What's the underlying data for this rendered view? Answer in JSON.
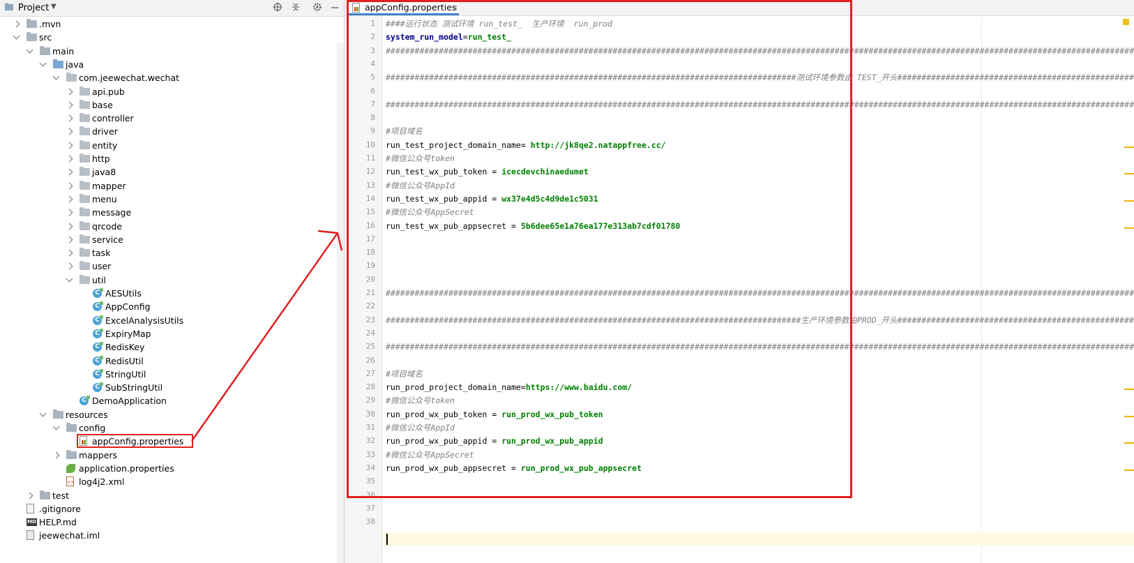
{
  "project_panel": {
    "title": "Project",
    "icons": [
      "locate-icon",
      "collapse-icon",
      "gear-icon",
      "minimize-icon"
    ],
    "tree": [
      {
        "label": ".mvn",
        "depth": 1,
        "expand": "collapsed",
        "icon": "folder"
      },
      {
        "label": "src",
        "depth": 1,
        "expand": "expanded",
        "icon": "folder"
      },
      {
        "label": "main",
        "depth": 2,
        "expand": "expanded",
        "icon": "folder"
      },
      {
        "label": "java",
        "depth": 3,
        "expand": "expanded",
        "icon": "folder-src"
      },
      {
        "label": "com.jeewechat.wechat",
        "depth": 4,
        "expand": "expanded",
        "icon": "package"
      },
      {
        "label": "api.pub",
        "depth": 5,
        "expand": "collapsed",
        "icon": "package"
      },
      {
        "label": "base",
        "depth": 5,
        "expand": "collapsed",
        "icon": "package"
      },
      {
        "label": "controller",
        "depth": 5,
        "expand": "collapsed",
        "icon": "package"
      },
      {
        "label": "driver",
        "depth": 5,
        "expand": "collapsed",
        "icon": "package"
      },
      {
        "label": "entity",
        "depth": 5,
        "expand": "collapsed",
        "icon": "package"
      },
      {
        "label": "http",
        "depth": 5,
        "expand": "collapsed",
        "icon": "package"
      },
      {
        "label": "java8",
        "depth": 5,
        "expand": "collapsed",
        "icon": "package"
      },
      {
        "label": "mapper",
        "depth": 5,
        "expand": "collapsed",
        "icon": "package"
      },
      {
        "label": "menu",
        "depth": 5,
        "expand": "collapsed",
        "icon": "package"
      },
      {
        "label": "message",
        "depth": 5,
        "expand": "collapsed",
        "icon": "package"
      },
      {
        "label": "qrcode",
        "depth": 5,
        "expand": "collapsed",
        "icon": "package"
      },
      {
        "label": "service",
        "depth": 5,
        "expand": "collapsed",
        "icon": "package"
      },
      {
        "label": "task",
        "depth": 5,
        "expand": "collapsed",
        "icon": "package"
      },
      {
        "label": "user",
        "depth": 5,
        "expand": "collapsed",
        "icon": "package"
      },
      {
        "label": "util",
        "depth": 5,
        "expand": "expanded",
        "icon": "package"
      },
      {
        "label": "AESUtils",
        "depth": 6,
        "expand": "none",
        "icon": "class"
      },
      {
        "label": "AppConfig",
        "depth": 6,
        "expand": "none",
        "icon": "class"
      },
      {
        "label": "ExcelAnalysisUtils",
        "depth": 6,
        "expand": "none",
        "icon": "class"
      },
      {
        "label": "ExpiryMap",
        "depth": 6,
        "expand": "none",
        "icon": "class"
      },
      {
        "label": "RedisKey",
        "depth": 6,
        "expand": "none",
        "icon": "class"
      },
      {
        "label": "RedisUtil",
        "depth": 6,
        "expand": "none",
        "icon": "class"
      },
      {
        "label": "StringUtil",
        "depth": 6,
        "expand": "none",
        "icon": "class"
      },
      {
        "label": "SubStringUtil",
        "depth": 6,
        "expand": "none",
        "icon": "class"
      },
      {
        "label": "DemoApplication",
        "depth": 5,
        "expand": "none",
        "icon": "class"
      },
      {
        "label": "resources",
        "depth": 3,
        "expand": "expanded",
        "icon": "folder-res"
      },
      {
        "label": "config",
        "depth": 4,
        "expand": "expanded",
        "icon": "folder"
      },
      {
        "label": "appConfig.properties",
        "depth": 5,
        "expand": "none",
        "icon": "properties"
      },
      {
        "label": "mappers",
        "depth": 4,
        "expand": "collapsed",
        "icon": "folder"
      },
      {
        "label": "application.properties",
        "depth": 4,
        "expand": "none",
        "icon": "spring-leaf"
      },
      {
        "label": "log4j2.xml",
        "depth": 4,
        "expand": "none",
        "icon": "xml"
      },
      {
        "label": "test",
        "depth": 2,
        "expand": "collapsed",
        "icon": "folder"
      },
      {
        "label": ".gitignore",
        "depth": 1,
        "expand": "none",
        "icon": "gitignore"
      },
      {
        "label": "HELP.md",
        "depth": 1,
        "expand": "none",
        "icon": "markdown"
      },
      {
        "label": "jeewechat.iml",
        "depth": 1,
        "expand": "none",
        "icon": "iml"
      }
    ]
  },
  "editor": {
    "tab": {
      "label": "appConfig.properties",
      "close": "×"
    },
    "lines": [
      {
        "n": "1",
        "kind": "comment",
        "text": "####运行状态 测试环境 run_test_  生产环境  run_prod"
      },
      {
        "n": "2",
        "kind": "kv",
        "key": "system_run_model",
        "sep": "=",
        "value": "run_test_"
      },
      {
        "n": "3",
        "kind": "hashes",
        "text": "################################################################################################################################################################################################################################"
      },
      {
        "n": "4",
        "kind": "blank"
      },
      {
        "n": "5",
        "kind": "hashes",
        "text": "#####################################################################################测试环境参数由 TEST_开头#########################################################################################################"
      },
      {
        "n": "6",
        "kind": "blank"
      },
      {
        "n": "7",
        "kind": "hashes",
        "text": "################################################################################################################################################################################################################################"
      },
      {
        "n": "8",
        "kind": "blank"
      },
      {
        "n": "9",
        "kind": "comment",
        "text": "#项目域名"
      },
      {
        "n": "10",
        "kind": "kv",
        "key": "run_test_project_domain_name",
        "sep": "= ",
        "value": "http://jk8qe2.natappfree.cc/"
      },
      {
        "n": "11",
        "kind": "comment",
        "text": "#微信公众号token"
      },
      {
        "n": "12",
        "kind": "kv",
        "key": "run_test_wx_pub_token",
        "sep": " = ",
        "value": "icecdevchinaedumet"
      },
      {
        "n": "13",
        "kind": "comment",
        "text": "#微信公众号AppId"
      },
      {
        "n": "14",
        "kind": "kv",
        "key": "run_test_wx_pub_appid",
        "sep": " = ",
        "value": "wx37e4d5c4d9de1c5031"
      },
      {
        "n": "15",
        "kind": "comment",
        "text": "#微信公众号AppSecret"
      },
      {
        "n": "16",
        "kind": "kv",
        "key": "run_test_wx_pub_appsecret",
        "sep": " = ",
        "value": "5b6dee65e1a76ea177e313ab7cdf01780"
      },
      {
        "n": "17",
        "kind": "blank"
      },
      {
        "n": "18",
        "kind": "blank"
      },
      {
        "n": "19",
        "kind": "blank"
      },
      {
        "n": "20",
        "kind": "blank"
      },
      {
        "n": "21",
        "kind": "hashes",
        "text": "################################################################################################################################################################################################################################"
      },
      {
        "n": "22",
        "kind": "blank"
      },
      {
        "n": "23",
        "kind": "hashes",
        "text": "######################################################################################生产环境参数由PROD_开头#########################################################################################################"
      },
      {
        "n": "24",
        "kind": "blank"
      },
      {
        "n": "25",
        "kind": "hashes",
        "text": "################################################################################################################################################################################################################################"
      },
      {
        "n": "26",
        "kind": "blank"
      },
      {
        "n": "27",
        "kind": "comment",
        "text": "#项目域名"
      },
      {
        "n": "28",
        "kind": "kv",
        "key": "run_prod_project_domain_name",
        "sep": "=",
        "value": "https://www.baidu.com/"
      },
      {
        "n": "29",
        "kind": "comment",
        "text": "#微信公众号token"
      },
      {
        "n": "30",
        "kind": "kv",
        "key": "run_prod_wx_pub_token",
        "sep": " = ",
        "value": "run_prod_wx_pub_token"
      },
      {
        "n": "31",
        "kind": "comment",
        "text": "#微信公众号AppId"
      },
      {
        "n": "32",
        "kind": "kv",
        "key": "run_prod_wx_pub_appid",
        "sep": " = ",
        "value": "run_prod_wx_pub_appid"
      },
      {
        "n": "33",
        "kind": "comment",
        "text": "#微信公众号AppSecret"
      },
      {
        "n": "34",
        "kind": "kv",
        "key": "run_prod_wx_pub_appsecret",
        "sep": " = ",
        "value": "run_prod_wx_pub_appsecret"
      },
      {
        "n": "35",
        "kind": "blank"
      },
      {
        "n": "36",
        "kind": "blank"
      },
      {
        "n": "37",
        "kind": "blank"
      },
      {
        "n": "38",
        "kind": "blank"
      }
    ],
    "warning_lines": [
      10,
      12,
      14,
      16,
      28,
      30,
      32,
      34
    ]
  },
  "colors": {
    "annotation_red": "#e02020",
    "key_blue": "#000080",
    "value_green": "#008000",
    "comment_gray": "#808080",
    "current_line": "#fffae3",
    "warning": "#f0b400"
  }
}
